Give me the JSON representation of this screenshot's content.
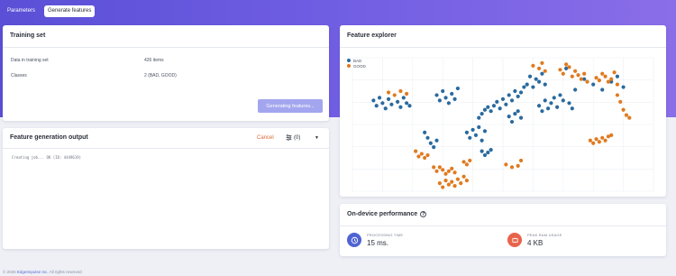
{
  "tabs": [
    {
      "label": "Parameters",
      "active": false
    },
    {
      "label": "Generate features",
      "active": true
    }
  ],
  "training": {
    "title": "Training set",
    "rows": [
      {
        "label": "Data in training set",
        "value": "426 items"
      },
      {
        "label": "Classes",
        "value": "2 (BAD, GOOD)"
      }
    ],
    "button_label": "Generating features..."
  },
  "output": {
    "title": "Feature generation output",
    "cancel_label": "Cancel",
    "filter_label": "(0)",
    "log_text": "Creating job... OK (ID: 4449619)"
  },
  "explorer": {
    "title": "Feature explorer",
    "legend": [
      {
        "name": "BAD",
        "color": "#2a6a9e"
      },
      {
        "name": "GOOD",
        "color": "#e07a1f"
      }
    ]
  },
  "chart_data": {
    "type": "scatter",
    "title": "",
    "xlabel": "",
    "ylabel": "",
    "xlim": [
      0,
      100
    ],
    "ylim": [
      0,
      100
    ],
    "grid": true,
    "legend_position": "top-left",
    "series": [
      {
        "name": "BAD",
        "color": "#2a6a9e",
        "points": [
          [
            7,
            68
          ],
          [
            8,
            64
          ],
          [
            9,
            70
          ],
          [
            10,
            66
          ],
          [
            11,
            62
          ],
          [
            12,
            69
          ],
          [
            13,
            65
          ],
          [
            15,
            67
          ],
          [
            16,
            63
          ],
          [
            17,
            70
          ],
          [
            18,
            66
          ],
          [
            19,
            64
          ],
          [
            28,
            72
          ],
          [
            29,
            68
          ],
          [
            30,
            75
          ],
          [
            31,
            70
          ],
          [
            32,
            66
          ],
          [
            33,
            73
          ],
          [
            34,
            69
          ],
          [
            35,
            77
          ],
          [
            25,
            40
          ],
          [
            26,
            36
          ],
          [
            27,
            33
          ],
          [
            28,
            38
          ],
          [
            24,
            44
          ],
          [
            38,
            44
          ],
          [
            39,
            40
          ],
          [
            40,
            46
          ],
          [
            41,
            42
          ],
          [
            42,
            48
          ],
          [
            43,
            38
          ],
          [
            44,
            45
          ],
          [
            42,
            55
          ],
          [
            43,
            58
          ],
          [
            44,
            61
          ],
          [
            45,
            63
          ],
          [
            46,
            60
          ],
          [
            47,
            64
          ],
          [
            48,
            67
          ],
          [
            49,
            62
          ],
          [
            50,
            69
          ],
          [
            51,
            65
          ],
          [
            52,
            72
          ],
          [
            53,
            68
          ],
          [
            54,
            75
          ],
          [
            55,
            71
          ],
          [
            56,
            74
          ],
          [
            57,
            78
          ],
          [
            43,
            30
          ],
          [
            44,
            27
          ],
          [
            45,
            29
          ],
          [
            46,
            31
          ],
          [
            52,
            56
          ],
          [
            53,
            52
          ],
          [
            54,
            58
          ],
          [
            55,
            60
          ],
          [
            56,
            55
          ],
          [
            58,
            80
          ],
          [
            59,
            86
          ],
          [
            60,
            78
          ],
          [
            61,
            84
          ],
          [
            62,
            82
          ],
          [
            63,
            88
          ],
          [
            64,
            80
          ],
          [
            62,
            64
          ],
          [
            63,
            60
          ],
          [
            64,
            68
          ],
          [
            65,
            62
          ],
          [
            66,
            66
          ],
          [
            67,
            70
          ],
          [
            68,
            63
          ],
          [
            69,
            72
          ],
          [
            70,
            68
          ],
          [
            72,
            66
          ],
          [
            73,
            62
          ],
          [
            71,
            92
          ],
          [
            74,
            76
          ],
          [
            77,
            84
          ],
          [
            80,
            80
          ],
          [
            83,
            76
          ],
          [
            86,
            82
          ],
          [
            88,
            86
          ],
          [
            90,
            78
          ]
        ]
      },
      {
        "name": "GOOD",
        "color": "#e07a1f",
        "points": [
          [
            12,
            74
          ],
          [
            14,
            72
          ],
          [
            16,
            75
          ],
          [
            18,
            73
          ],
          [
            21,
            30
          ],
          [
            22,
            26
          ],
          [
            23,
            28
          ],
          [
            24,
            25
          ],
          [
            25,
            27
          ],
          [
            27,
            18
          ],
          [
            28,
            15
          ],
          [
            29,
            18
          ],
          [
            30,
            16
          ],
          [
            31,
            13
          ],
          [
            32,
            15
          ],
          [
            33,
            17
          ],
          [
            34,
            14
          ],
          [
            29,
            6
          ],
          [
            30,
            3
          ],
          [
            31,
            8
          ],
          [
            32,
            5
          ],
          [
            33,
            7
          ],
          [
            34,
            4
          ],
          [
            35,
            9
          ],
          [
            36,
            6
          ],
          [
            37,
            11
          ],
          [
            38,
            8
          ],
          [
            37,
            22
          ],
          [
            38,
            20
          ],
          [
            39,
            23
          ],
          [
            60,
            94
          ],
          [
            62,
            92
          ],
          [
            63,
            96
          ],
          [
            64,
            90
          ],
          [
            69,
            91
          ],
          [
            70,
            88
          ],
          [
            71,
            95
          ],
          [
            72,
            93
          ],
          [
            73,
            86
          ],
          [
            74,
            90
          ],
          [
            75,
            87
          ],
          [
            76,
            84
          ],
          [
            77,
            88
          ],
          [
            78,
            82
          ],
          [
            81,
            85
          ],
          [
            82,
            83
          ],
          [
            83,
            88
          ],
          [
            84,
            86
          ],
          [
            85,
            82
          ],
          [
            86,
            84
          ],
          [
            87,
            89
          ],
          [
            88,
            80
          ],
          [
            88,
            72
          ],
          [
            89,
            67
          ],
          [
            90,
            61
          ],
          [
            91,
            57
          ],
          [
            92,
            55
          ],
          [
            79,
            38
          ],
          [
            80,
            36
          ],
          [
            81,
            39
          ],
          [
            82,
            37
          ],
          [
            83,
            40
          ],
          [
            84,
            38
          ],
          [
            85,
            41
          ],
          [
            86,
            42
          ],
          [
            51,
            20
          ],
          [
            53,
            18
          ],
          [
            55,
            19
          ],
          [
            56,
            23
          ]
        ]
      }
    ]
  },
  "perf": {
    "title": "On-device performance",
    "metrics": [
      {
        "label": "PROCESSING TIME",
        "value": "15 ms.",
        "icon_color": "#4f63d2",
        "icon": "clock-icon"
      },
      {
        "label": "PEAK RAM USAGE",
        "value": "4 KB",
        "icon_color": "#e9634b",
        "icon": "memory-icon"
      }
    ]
  },
  "footer": {
    "prefix": "© 2025",
    "link_text": "EdgeImpulse Inc.",
    "suffix": "All rights reserved"
  }
}
